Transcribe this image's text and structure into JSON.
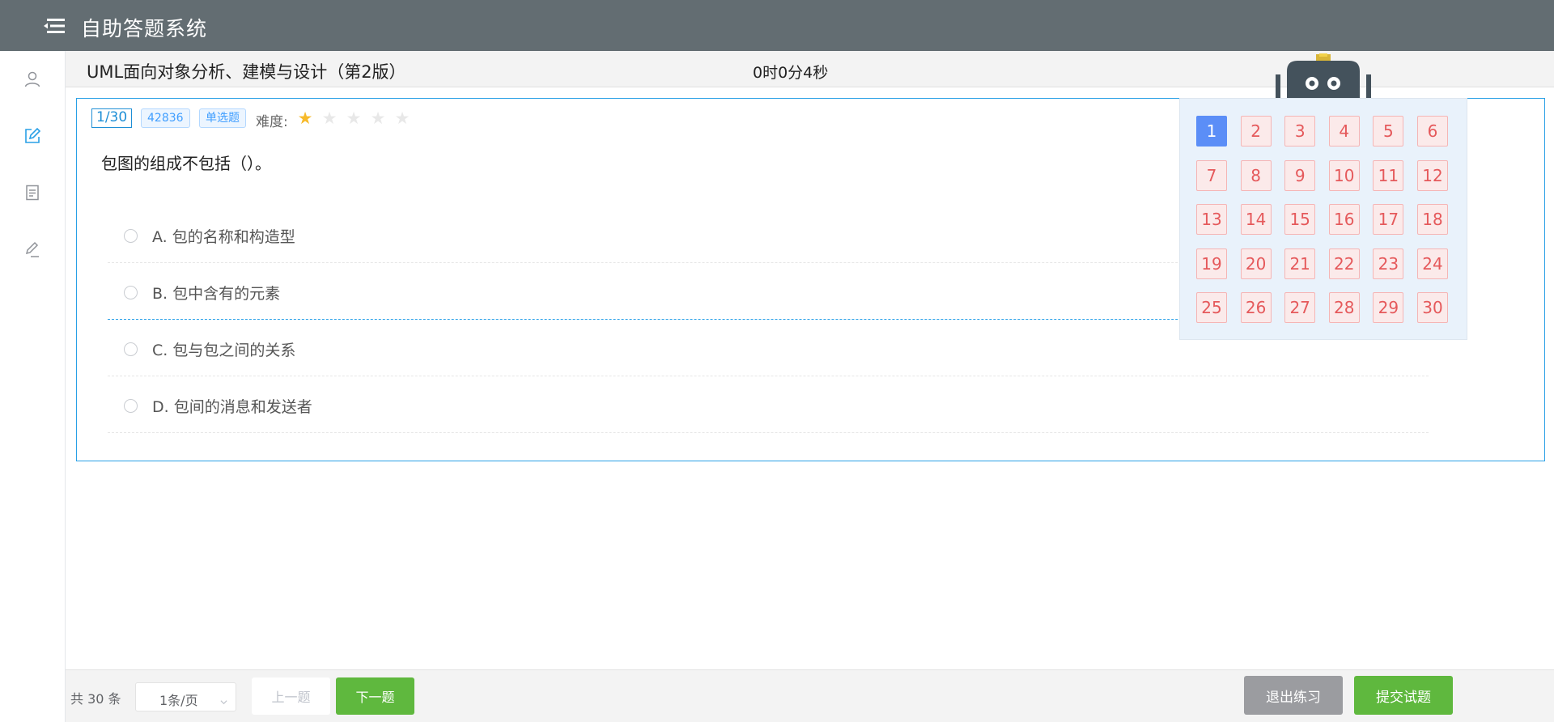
{
  "app": {
    "title": "自助答题系统"
  },
  "sidebar": {
    "items": [
      {
        "icon": "user-icon"
      },
      {
        "icon": "edit-icon",
        "active": true
      },
      {
        "icon": "document-icon"
      },
      {
        "icon": "pencil-icon"
      }
    ]
  },
  "exam": {
    "course_title": "UML面向对象分析、建模与设计（第2版）",
    "timer": "0时0分4秒"
  },
  "question": {
    "index": "1/30",
    "id": "42836",
    "type": "单选题",
    "difficulty_label": "难度:",
    "difficulty_rating": 1,
    "difficulty_max": 5,
    "text": "包图的组成不包括（）。",
    "options": [
      {
        "label": "A. 包的名称和构造型"
      },
      {
        "label": "B. 包中含有的元素",
        "hovered": true
      },
      {
        "label": "C. 包与包之间的关系"
      },
      {
        "label": "D. 包间的消息和发送者"
      }
    ]
  },
  "navigator": {
    "current": 1,
    "numbers": [
      "1",
      "2",
      "3",
      "4",
      "5",
      "6",
      "7",
      "8",
      "9",
      "10",
      "11",
      "12",
      "13",
      "14",
      "15",
      "16",
      "17",
      "18",
      "19",
      "20",
      "21",
      "22",
      "23",
      "24",
      "25",
      "26",
      "27",
      "28",
      "29",
      "30"
    ]
  },
  "footer": {
    "total": "共 30 条",
    "page_size": "1条/页",
    "prev_label": "上一题",
    "next_label": "下一题",
    "exit_label": "退出练习",
    "submit_label": "提交试题"
  },
  "colors": {
    "header_bg": "#636d72",
    "accent_blue": "#29a0e6",
    "success_green": "#5fb83e",
    "current_number": "#5b8ef7",
    "unanswered_number": "#e5595b",
    "star_on": "#f7ba2a"
  }
}
